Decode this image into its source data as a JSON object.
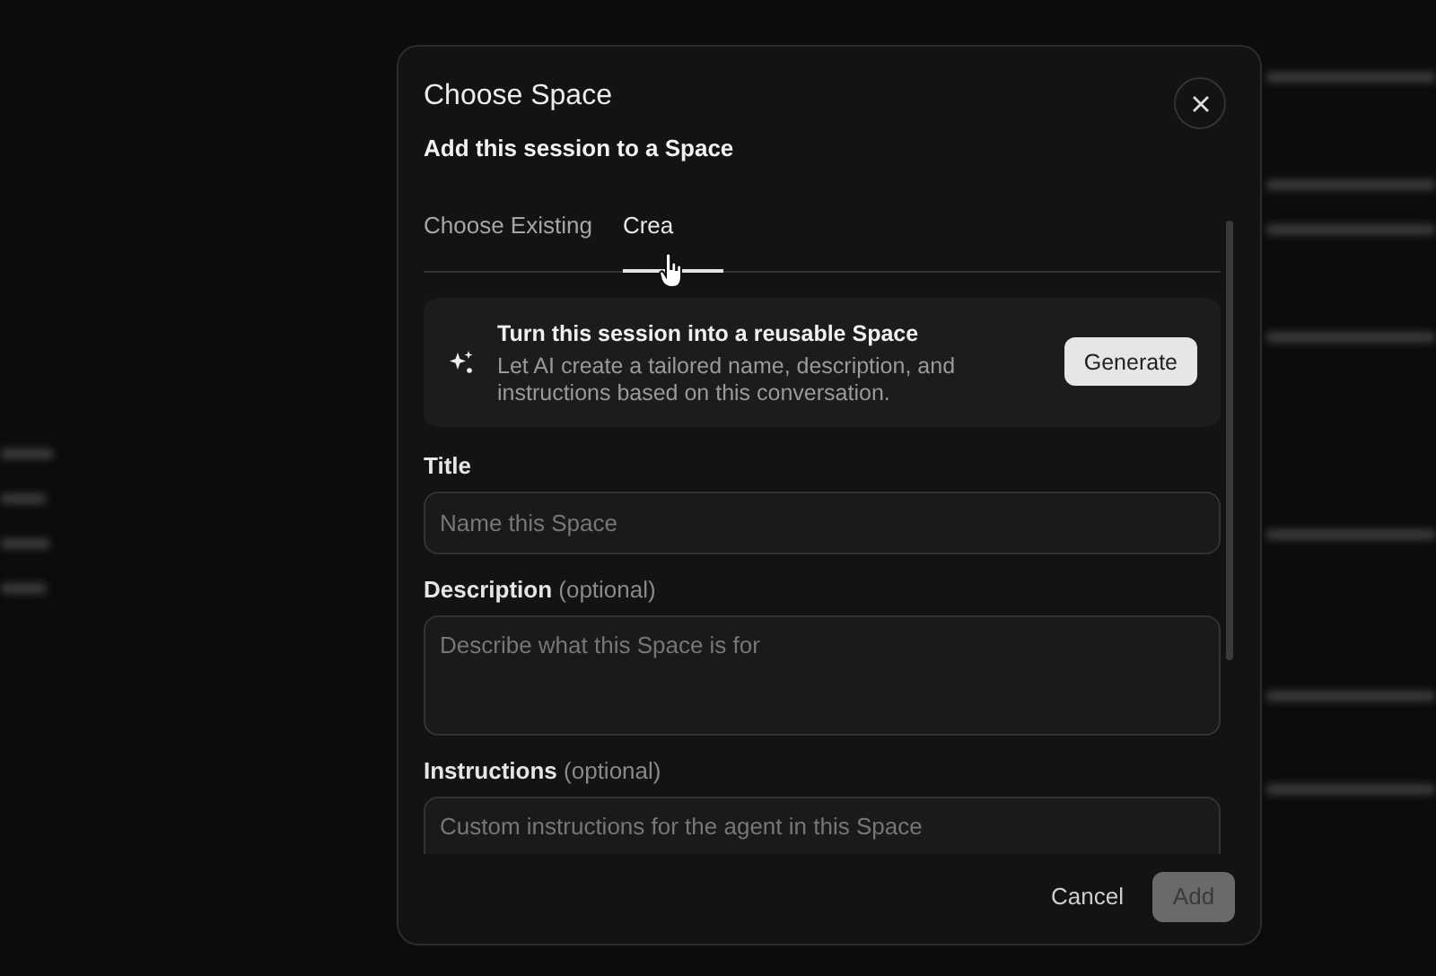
{
  "dialog": {
    "title": "Choose Space",
    "subtitle": "Add this session to a Space"
  },
  "tabs": [
    {
      "label": "Choose Existing",
      "selected": false
    },
    {
      "label": "Crea",
      "selected": true
    }
  ],
  "generate_card": {
    "title": "Turn this session into a reusable Space",
    "description": "Let AI create a tailored name, description, and instructions based on this conversation.",
    "button": "Generate"
  },
  "fields": [
    {
      "kind": "input",
      "label": "Title",
      "placeholder": "Name this Space"
    },
    {
      "kind": "textarea",
      "label": "Description",
      "optional": "(optional)",
      "placeholder": "Describe what this Space is for"
    },
    {
      "kind": "textarea",
      "label": "Instructions",
      "optional": "(optional)",
      "placeholder": "Custom instructions for the agent in this Space"
    }
  ],
  "footer": {
    "cancel": "Cancel",
    "add": {
      "label": "Add",
      "disabled": true
    }
  }
}
